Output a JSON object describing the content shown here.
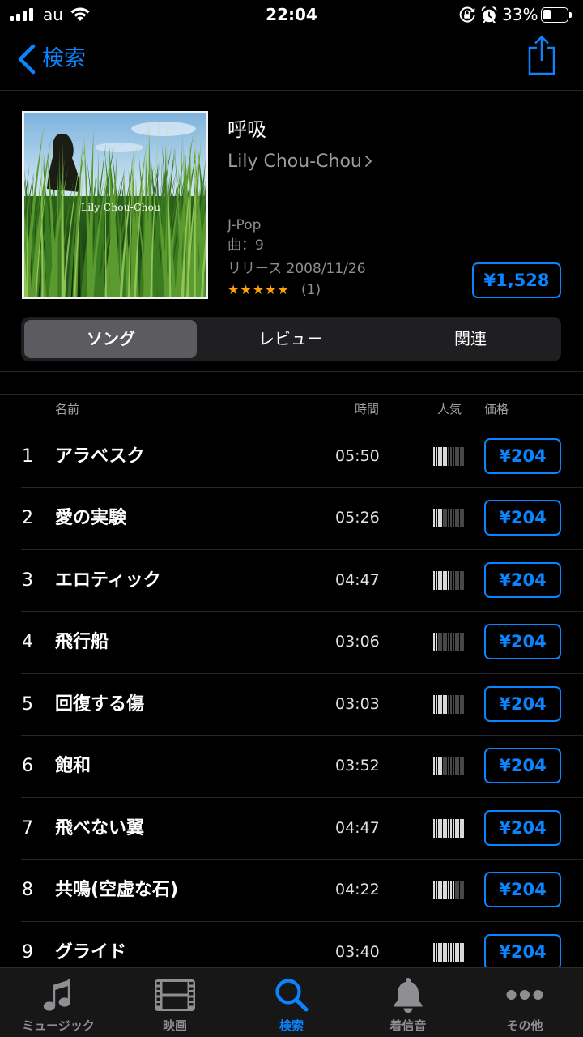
{
  "colors": {
    "background": "#000000",
    "accent": "#0a84ff",
    "secondary_text": "#98989d",
    "star": "#ff9f0a"
  },
  "status_bar": {
    "carrier": "au",
    "time": "22:04",
    "battery_text": "33%",
    "battery_level": 0.33,
    "icons": [
      "signal-icon",
      "wifi-icon",
      "orientation-lock-icon",
      "alarm-icon",
      "battery-icon"
    ]
  },
  "nav": {
    "back_label": "検索",
    "back_icon": "chevron-left-icon",
    "share_icon": "share-icon"
  },
  "album": {
    "cover_text": "Lily Chou-Chou",
    "title": "呼吸",
    "artist": "Lily Chou-Chou",
    "artist_icon": "chevron-right-icon",
    "genre": "J-Pop",
    "track_count": "曲：9",
    "release": "リリース 2008/11/26",
    "stars": "★★★★★",
    "rating": 5,
    "rating_count": "(1)",
    "price": "¥1,528"
  },
  "segments": [
    {
      "label": "ソング",
      "selected": true
    },
    {
      "label": "レビュー",
      "selected": false
    },
    {
      "label": "関連",
      "selected": false
    }
  ],
  "track_table": {
    "columns": {
      "name": "名前",
      "time": "時間",
      "popularity": "人気",
      "price": "価格"
    },
    "tracks": [
      {
        "number": "1",
        "title": "アラベスク",
        "duration": "05:50",
        "popularity": 0.45,
        "price": "¥204"
      },
      {
        "number": "2",
        "title": "愛の実験",
        "duration": "05:26",
        "popularity": 0.3,
        "price": "¥204"
      },
      {
        "number": "3",
        "title": "エロティック",
        "duration": "04:47",
        "popularity": 0.55,
        "price": "¥204"
      },
      {
        "number": "4",
        "title": "飛行船",
        "duration": "03:06",
        "popularity": 0.15,
        "price": "¥204"
      },
      {
        "number": "5",
        "title": "回復する傷",
        "duration": "03:03",
        "popularity": 0.45,
        "price": "¥204"
      },
      {
        "number": "6",
        "title": "飽和",
        "duration": "03:52",
        "popularity": 0.3,
        "price": "¥204"
      },
      {
        "number": "7",
        "title": "飛べない翼",
        "duration": "04:47",
        "popularity": 1.0,
        "price": "¥204"
      },
      {
        "number": "8",
        "title": "共鳴(空虚な石)",
        "duration": "04:22",
        "popularity": 0.7,
        "price": "¥204"
      },
      {
        "number": "9",
        "title": "グライド",
        "duration": "03:40",
        "popularity": 1.0,
        "price": "¥204"
      }
    ]
  },
  "tab_bar": [
    {
      "label": "ミュージック",
      "icon": "music-note-icon",
      "selected": false
    },
    {
      "label": "映画",
      "icon": "film-icon",
      "selected": false
    },
    {
      "label": "検索",
      "icon": "search-icon",
      "selected": true
    },
    {
      "label": "着信音",
      "icon": "bell-icon",
      "selected": false
    },
    {
      "label": "その他",
      "icon": "more-icon",
      "selected": false
    }
  ]
}
